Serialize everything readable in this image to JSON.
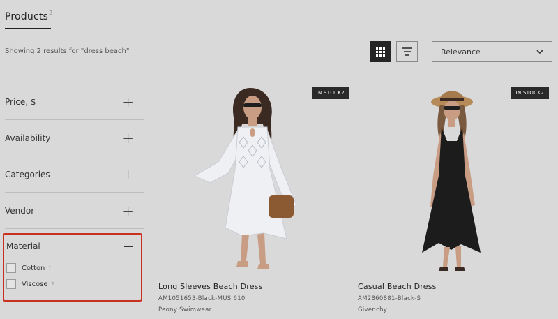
{
  "header": {
    "tab_label": "Products",
    "tab_count": "2",
    "results_text": "Showing 2 results for \"dress beach\""
  },
  "toolbar": {
    "grid_icon": "grid-view-icon",
    "list_icon": "list-view-icon",
    "sort_value": "Relevance"
  },
  "filters": {
    "items": [
      {
        "label": "Price, $",
        "icon": "plus-icon"
      },
      {
        "label": "Availability",
        "icon": "plus-icon"
      },
      {
        "label": "Categories",
        "icon": "plus-icon"
      },
      {
        "label": "Vendor",
        "icon": "plus-icon"
      }
    ],
    "material": {
      "label": "Material",
      "icon": "minus-icon",
      "options": [
        {
          "label": "Cotton",
          "count": "1"
        },
        {
          "label": "Viscose",
          "count": "1"
        }
      ]
    }
  },
  "products": [
    {
      "badge": "IN STOCK2",
      "title": "Long Sleeves Beach Dress",
      "sku": "AM1051653-Black-MUS 610",
      "vendor": "Peony Swimwear"
    },
    {
      "badge": "IN STOCK2",
      "title": "Casual Beach Dress",
      "sku": "AM2860881-Black-S",
      "vendor": "Givenchy"
    }
  ],
  "colors": {
    "background": "#d9d9d9",
    "highlight": "#c9301f",
    "dark": "#252525"
  }
}
